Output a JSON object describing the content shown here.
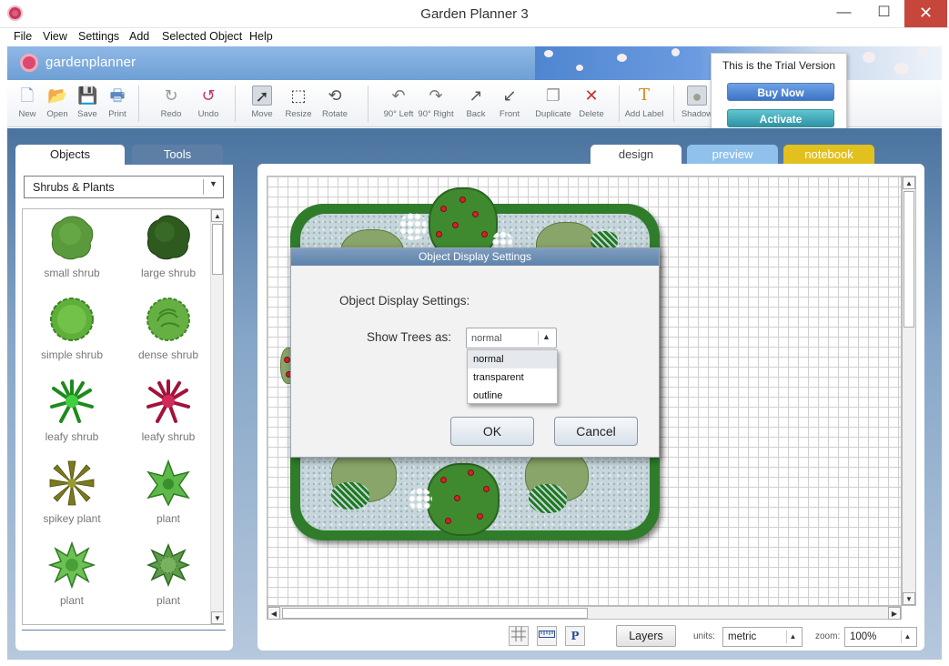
{
  "window": {
    "title": "Garden Planner 3",
    "minimize": "—",
    "maximize": "☐",
    "close": "✕"
  },
  "menu": [
    "File",
    "View",
    "Settings",
    "Add",
    "Selected Object",
    "Help"
  ],
  "brand": {
    "logo_text": "gardenplanner"
  },
  "toolbar": {
    "tools": [
      {
        "label": "New",
        "icon": "new-file-icon",
        "glyph": "🗋"
      },
      {
        "label": "Open",
        "icon": "open-folder-icon",
        "glyph": "📂"
      },
      {
        "label": "Save",
        "icon": "save-disk-icon",
        "glyph": "💾"
      },
      {
        "label": "Print",
        "icon": "print-icon",
        "glyph": "🖶"
      },
      {
        "label": "Redo",
        "icon": "redo-icon",
        "glyph": "↻"
      },
      {
        "label": "Undo",
        "icon": "undo-icon",
        "glyph": "↺"
      },
      {
        "label": "Move",
        "icon": "move-pointer-icon",
        "glyph": "➚"
      },
      {
        "label": "Resize",
        "icon": "resize-icon",
        "glyph": "⬚"
      },
      {
        "label": "Rotate",
        "icon": "rotate-icon",
        "glyph": "⟲"
      },
      {
        "label": "90° Left",
        "icon": "rotate-left-icon",
        "glyph": "↶"
      },
      {
        "label": "90° Right",
        "icon": "rotate-right-icon",
        "glyph": "↷"
      },
      {
        "label": "Back",
        "icon": "send-back-icon",
        "glyph": "↗"
      },
      {
        "label": "Front",
        "icon": "bring-front-icon",
        "glyph": "↙"
      },
      {
        "label": "Duplicate",
        "icon": "duplicate-icon",
        "glyph": "❐"
      },
      {
        "label": "Delete",
        "icon": "delete-icon",
        "glyph": "✕"
      },
      {
        "label": "Add Label",
        "icon": "add-label-icon",
        "glyph": "T"
      },
      {
        "label": "Shadow",
        "icon": "shadow-icon",
        "glyph": "●"
      }
    ]
  },
  "trial": {
    "message": "This is the Trial Version",
    "buy_label": "Buy Now",
    "activate_label": "Activate"
  },
  "left_panel": {
    "tabs": [
      "Objects",
      "Tools"
    ],
    "category": "Shrubs & Plants",
    "objects": [
      {
        "name": "small shrub"
      },
      {
        "name": "large shrub"
      },
      {
        "name": "simple shrub"
      },
      {
        "name": "dense shrub"
      },
      {
        "name": "leafy shrub"
      },
      {
        "name": "leafy shrub"
      },
      {
        "name": "spikey plant"
      },
      {
        "name": "plant"
      },
      {
        "name": "plant"
      },
      {
        "name": "plant"
      }
    ]
  },
  "view_tabs": [
    "design",
    "preview",
    "notebook"
  ],
  "bottom_bar": {
    "layers_label": "Layers",
    "units_label": "units:",
    "units_value": "metric",
    "zoom_label": "zoom:",
    "zoom_value": "100%",
    "p_icon": "P"
  },
  "dialog": {
    "title": "Object Display Settings",
    "heading": "Object Display Settings:",
    "show_trees_label": "Show Trees as:",
    "selected": "normal",
    "options": [
      "normal",
      "transparent",
      "outline"
    ],
    "ok_label": "OK",
    "cancel_label": "Cancel"
  },
  "colors": {
    "accent_blue": "#5f82aa",
    "notebook_tab": "#e2c01e",
    "preview_tab": "#8fc1ec",
    "close_red": "#c7463b",
    "bed_green": "#2f7d2b"
  }
}
